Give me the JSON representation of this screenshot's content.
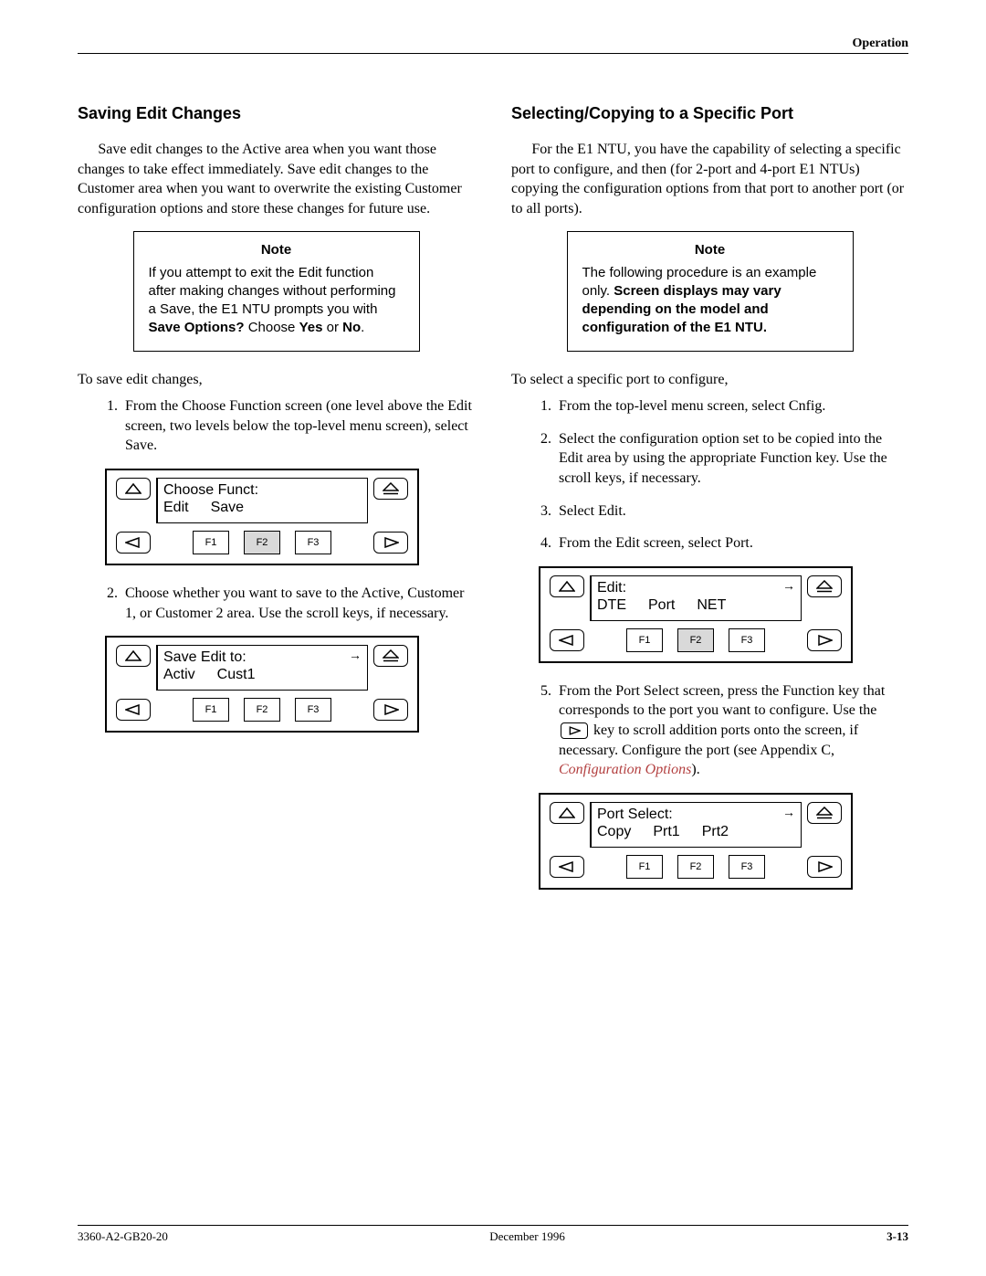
{
  "header": {
    "section": "Operation"
  },
  "left": {
    "heading": "Saving Edit Changes",
    "intro": "Save edit changes to the Active area when you want those changes to take effect immediately. Save edit changes to the Customer area when you want to overwrite the existing Customer configuration options and store these changes for future use.",
    "note": {
      "title": "Note",
      "pre": "If you attempt to exit the Edit function after making changes without performing a Save, the E1 NTU prompts you with ",
      "bold1": "Save Options?",
      "mid": " Choose ",
      "bold2": "Yes",
      "or": " or ",
      "bold3": "No",
      "end": "."
    },
    "lead": "To save edit changes,",
    "step1": "From the Choose Function screen (one level above the Edit screen, two levels below the top-level menu screen), select Save.",
    "step2": "Choose whether you want to save to the Active, Customer 1, or Customer 2 area. Use the scroll keys, if necessary.",
    "panel1": {
      "line1": "Choose Funct:",
      "opt1": "Edit",
      "opt2": "Save",
      "f1": "F1",
      "f2": "F2",
      "f3": "F3",
      "shaded": "F2",
      "arrow": false
    },
    "panel2": {
      "line1": "Save Edit to:",
      "opt1": "Activ",
      "opt2": "Cust1",
      "f1": "F1",
      "f2": "F2",
      "f3": "F3",
      "shaded": "",
      "arrow": true
    }
  },
  "right": {
    "heading": "Selecting/Copying to a Specific Port",
    "intro": "For the E1 NTU, you have the capability of selecting a specific port to configure, and then (for 2-port and 4-port E1 NTUs) copying the configuration options from that port to another port (or to all ports).",
    "note": {
      "title": "Note",
      "pre": "The following procedure is an example only. ",
      "bold": "Screen displays may vary depending on the model and configuration of the E1 NTU."
    },
    "lead": "To select a specific port to configure,",
    "step1": "From the top-level menu screen, select Cnfig.",
    "step2": "Select the configuration option set to be copied into the Edit area by using the appropriate Function key. Use the scroll keys, if necessary.",
    "step3": "Select Edit.",
    "step4": "From the Edit screen, select Port.",
    "step5a": "From the Port Select screen, press the Function key that corresponds to the port you want to configure. Use the ",
    "step5b": " key to scroll addition ports onto the screen, if necessary. Configure the port (see Appendix C, ",
    "step5link": "Configuration Options",
    "step5c": ").",
    "panel1": {
      "line1": "Edit:",
      "opt1": "DTE",
      "opt2": "Port",
      "opt3": "NET",
      "f1": "F1",
      "f2": "F2",
      "f3": "F3",
      "shaded": "F2",
      "arrow": true
    },
    "panel2": {
      "line1": "Port Select:",
      "opt1": "Copy",
      "opt2": "Prt1",
      "opt3": "Prt2",
      "f1": "F1",
      "f2": "F2",
      "f3": "F3",
      "shaded": "",
      "arrow": true
    }
  },
  "footer": {
    "left": "3360-A2-GB20-20",
    "center": "December 1996",
    "right": "3-13"
  }
}
